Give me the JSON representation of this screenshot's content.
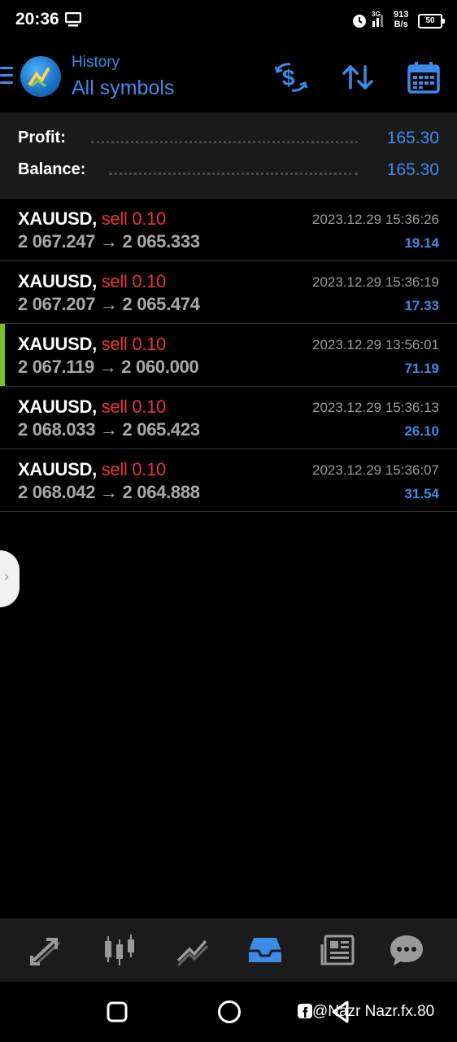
{
  "status": {
    "time": "20:36",
    "speed_top": "913",
    "speed_bottom": "B/s",
    "battery": "50"
  },
  "header": {
    "subtitle": "History",
    "title": "All symbols",
    "accent": "#3b8be8"
  },
  "summary": {
    "profit_label": "Profit:",
    "profit_value": "165.30",
    "balance_label": "Balance:",
    "balance_value": "165.30"
  },
  "trades": [
    {
      "symbol": "XAUUSD,",
      "side": "sell",
      "volume": "0.10",
      "open": "2 067.247",
      "arrow": "→",
      "close": "2 065.333",
      "time": "2023.12.29 15:36:26",
      "profit": "19.14"
    },
    {
      "symbol": "XAUUSD,",
      "side": "sell",
      "volume": "0.10",
      "open": "2 067.207",
      "arrow": "→",
      "close": "2 065.474",
      "time": "2023.12.29 15:36:19",
      "profit": "17.33"
    },
    {
      "symbol": "XAUUSD,",
      "side": "sell",
      "volume": "0.10",
      "open": "2 067.119",
      "arrow": "→",
      "close": "2 060.000",
      "time": "2023.12.29 13:56:01",
      "profit": "71.19"
    },
    {
      "symbol": "XAUUSD,",
      "side": "sell",
      "volume": "0.10",
      "open": "2 068.033",
      "arrow": "→",
      "close": "2 065.423",
      "time": "2023.12.29 15:36:13",
      "profit": "26.10"
    },
    {
      "symbol": "XAUUSD,",
      "side": "sell",
      "volume": "0.10",
      "open": "2 068.042",
      "arrow": "→",
      "close": "2 064.888",
      "time": "2023.12.29 15:36:07",
      "profit": "31.54"
    }
  ],
  "bottom_nav": [
    {
      "icon": "quotes-icon",
      "active": false
    },
    {
      "icon": "chart-icon",
      "active": false
    },
    {
      "icon": "trade-icon",
      "active": false
    },
    {
      "icon": "history-icon",
      "active": true
    },
    {
      "icon": "news-icon",
      "active": false
    },
    {
      "icon": "chat-icon",
      "active": false
    }
  ],
  "watermark": "@Nazr Nazr.fx.80"
}
